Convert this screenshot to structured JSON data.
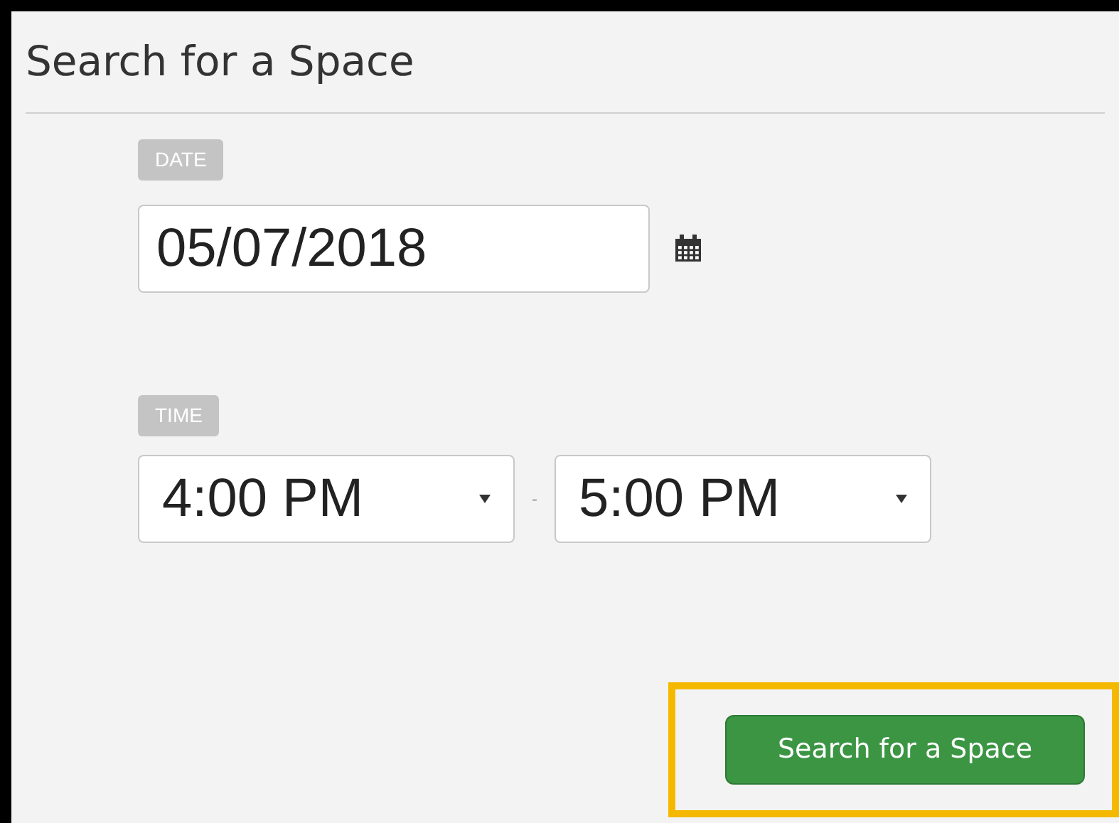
{
  "panel": {
    "title": "Search for a Space"
  },
  "date": {
    "label": "DATE",
    "value": "05/07/2018"
  },
  "time": {
    "label": "TIME",
    "start": "4:00 PM",
    "separator": "-",
    "end": "5:00 PM"
  },
  "search_button": {
    "label": "Search for a Space",
    "highlighted": true
  }
}
